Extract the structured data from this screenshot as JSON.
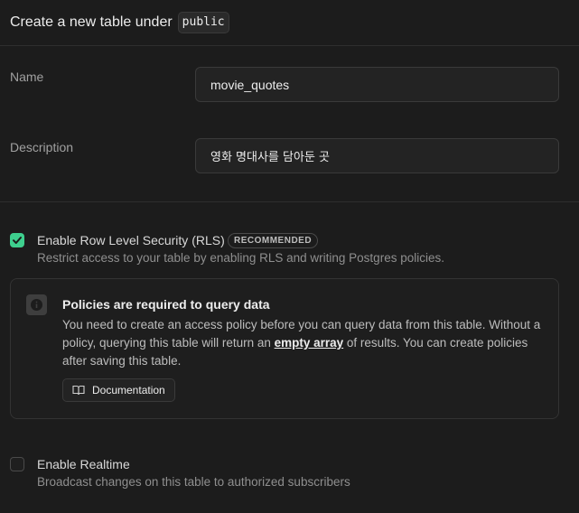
{
  "header": {
    "title": "Create a new table under",
    "schema": "public"
  },
  "form": {
    "name_label": "Name",
    "name_value": "movie_quotes",
    "description_label": "Description",
    "description_value": "영화 명대사를 담아둔 곳"
  },
  "rls": {
    "checked": true,
    "label": "Enable Row Level Security (RLS)",
    "badge": "RECOMMENDED",
    "description": "Restrict access to your table by enabling RLS and writing Postgres policies."
  },
  "callout": {
    "icon": "info-icon",
    "title": "Policies are required to query data",
    "body_before": "You need to create an access policy before you can query data from this table. Without a policy, querying this table will return an ",
    "body_link": "empty array",
    "body_after": " of results. You can create policies after saving this table.",
    "doc_button": "Documentation"
  },
  "realtime": {
    "checked": false,
    "label": "Enable Realtime",
    "description": "Broadcast changes on this table to authorized subscribers"
  },
  "colors": {
    "accent": "#3ecf8e",
    "background": "#1c1c1c"
  }
}
